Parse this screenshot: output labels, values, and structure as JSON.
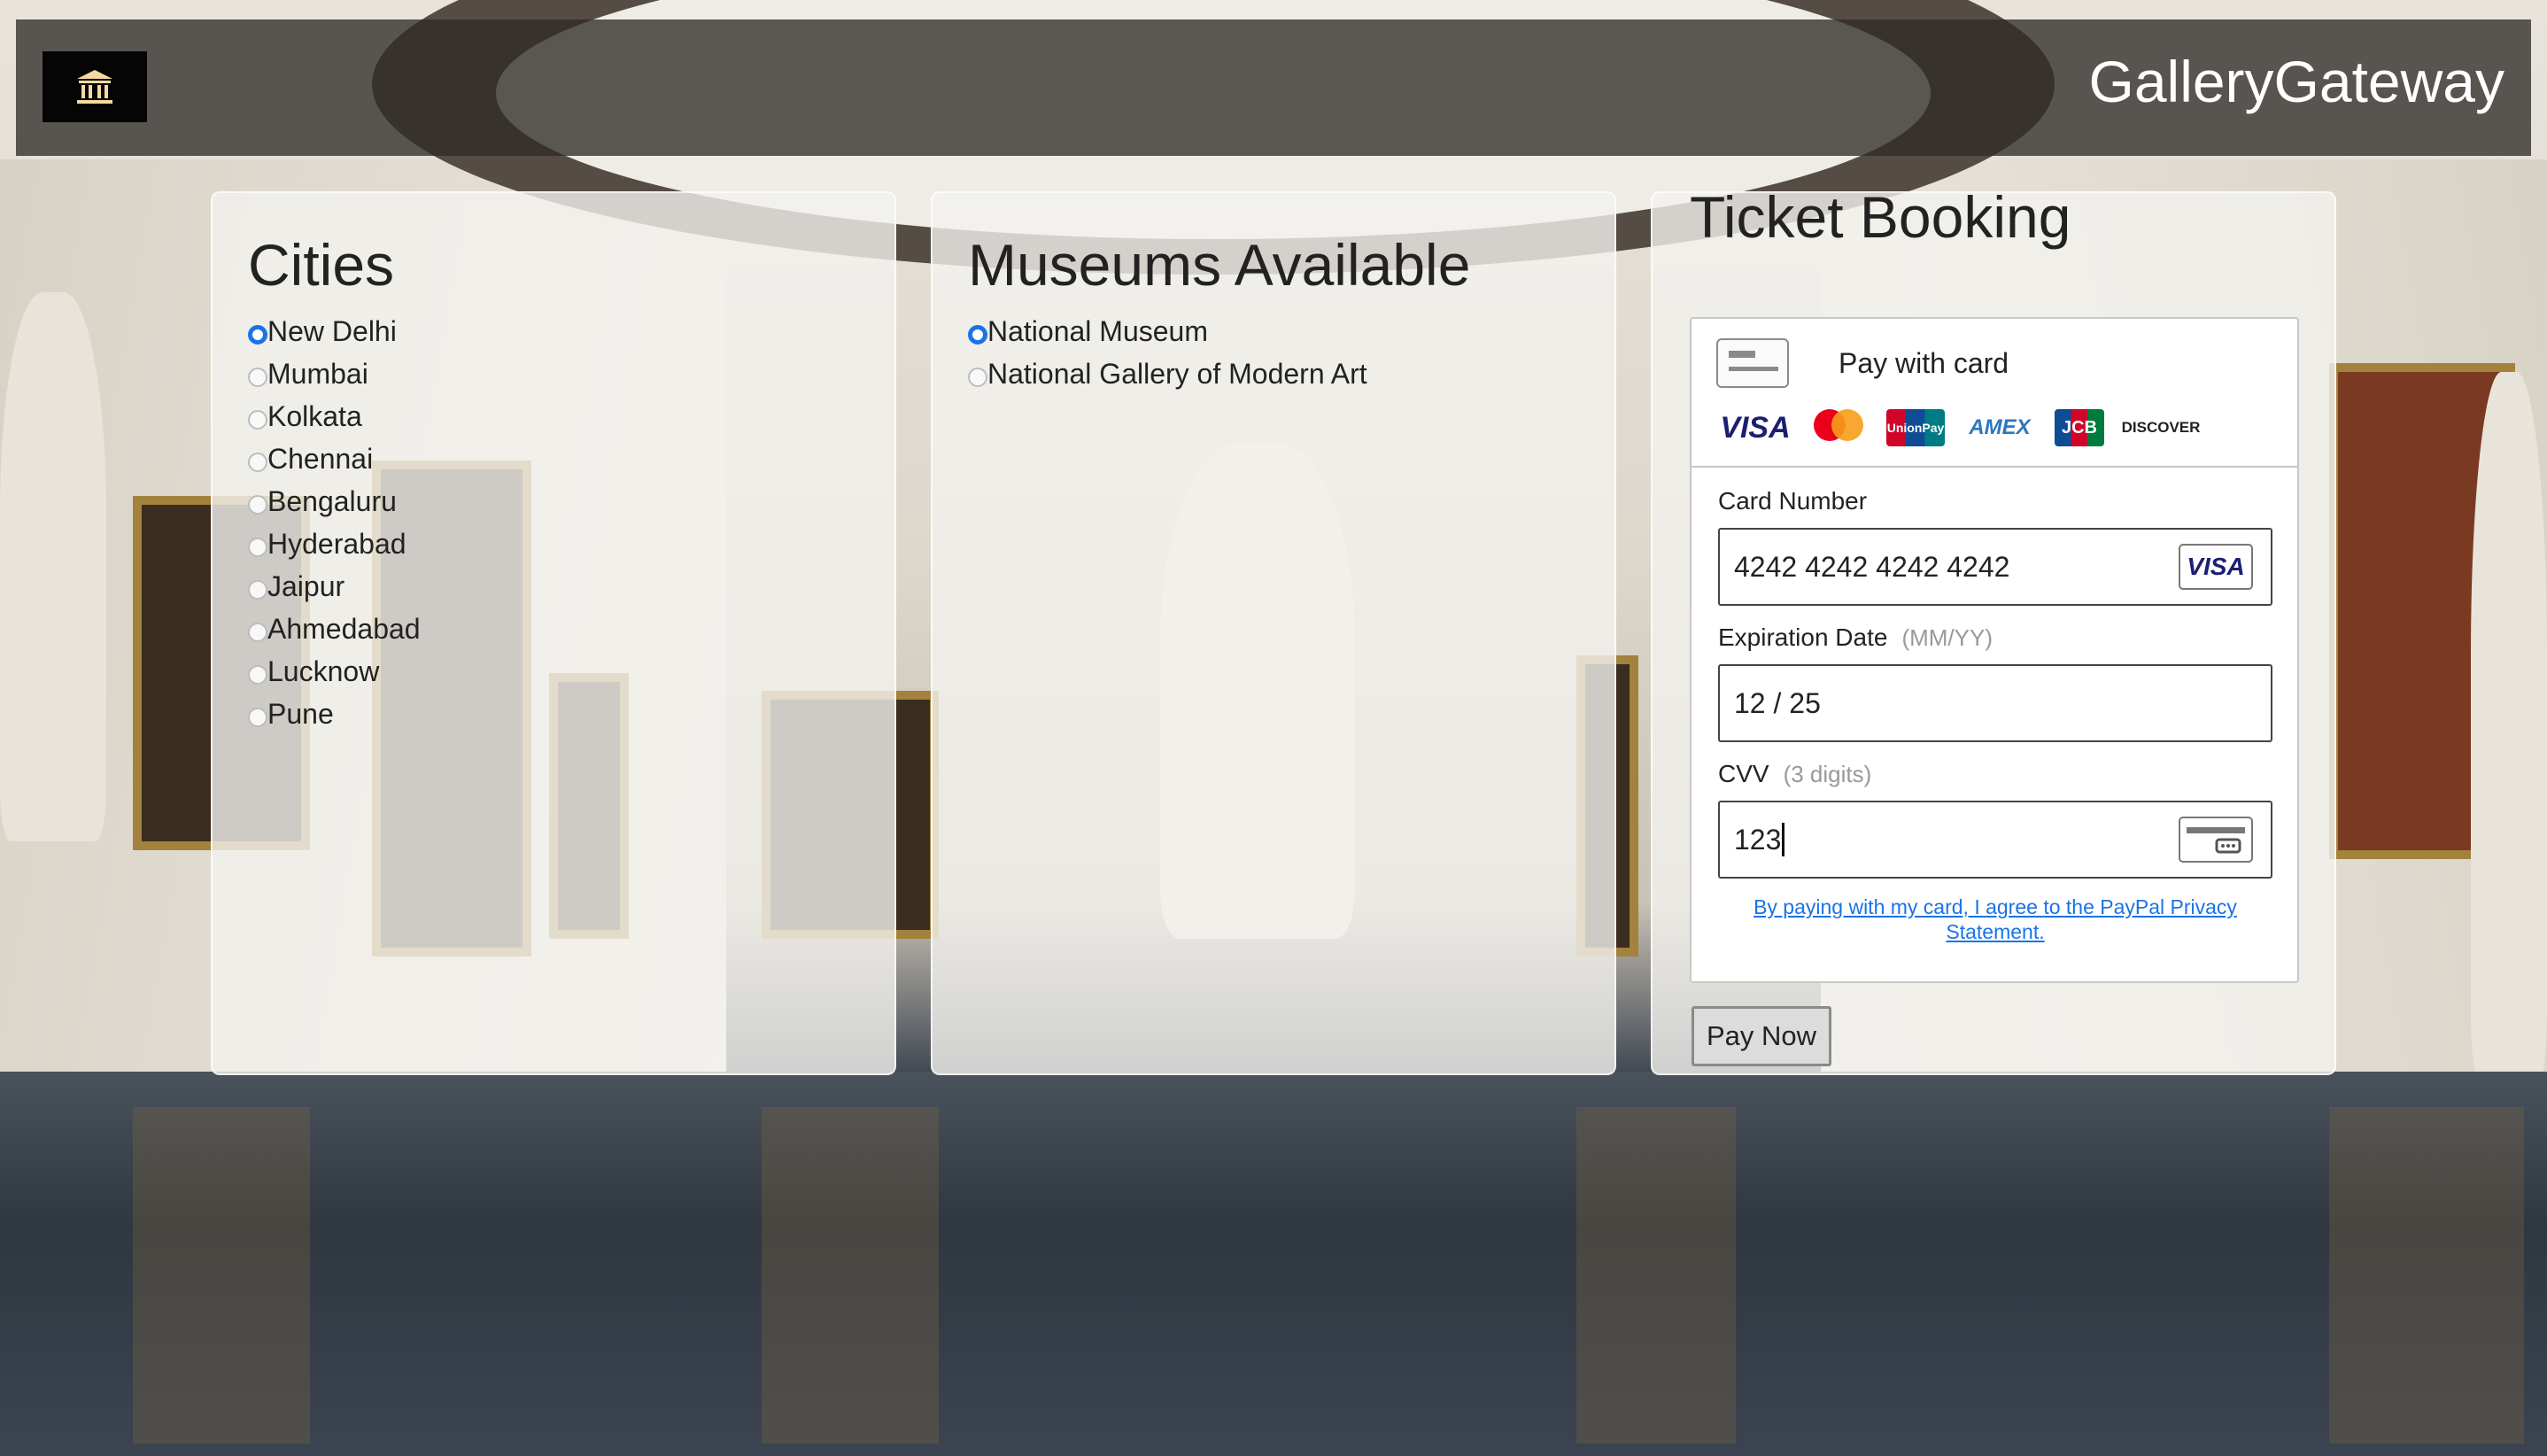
{
  "header": {
    "brand": "GalleryGateway",
    "logo_icon": "museum-icon"
  },
  "cities": {
    "title": "Cities",
    "selected": "New Delhi",
    "items": [
      "New Delhi",
      "Mumbai",
      "Kolkata",
      "Chennai",
      "Bengaluru",
      "Hyderabad",
      "Jaipur",
      "Ahmedabad",
      "Lucknow",
      "Pune"
    ]
  },
  "museums": {
    "title": "Museums Available",
    "selected": "National Museum",
    "items": [
      "National Museum",
      "National Gallery of Modern Art"
    ]
  },
  "booking": {
    "title": "Ticket Booking",
    "pay_with_card": "Pay with card",
    "card_brands": [
      "VISA",
      "mastercard",
      "UnionPay",
      "AMEX",
      "JCB",
      "DISCOVER"
    ],
    "card_number_label": "Card Number",
    "card_number_value": "4242 4242 4242 4242",
    "card_number_brand": "VISA",
    "expiry_label": "Expiration Date",
    "expiry_hint": "(MM/YY)",
    "expiry_value": "12 / 25",
    "cvv_label": "CVV",
    "cvv_hint": "(3 digits)",
    "cvv_value": "123",
    "privacy_text": "By paying with my card, I agree to the PayPal Privacy Statement.",
    "pay_button": "Pay Now"
  },
  "colors": {
    "radio_checked": "#1a73e8",
    "link": "#1a73e8",
    "header_bg": "#302c28"
  }
}
